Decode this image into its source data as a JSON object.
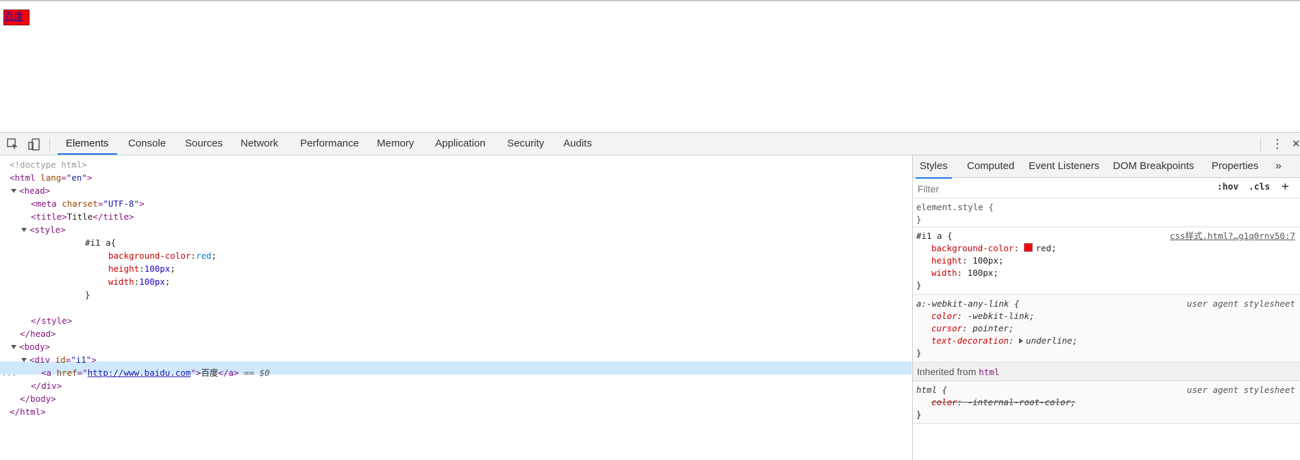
{
  "page": {
    "link_text": "百度"
  },
  "devtools": {
    "tabs": [
      "Elements",
      "Console",
      "Sources",
      "Network",
      "Performance",
      "Memory",
      "Application",
      "Security",
      "Audits"
    ],
    "more_tabs_glyph": "»",
    "menu_glyph": "⋮",
    "close_glyph": "✕"
  },
  "elements": {
    "doctype": "<!doctype html>",
    "html_open_tag": "html",
    "html_lang_attr": "lang",
    "html_lang_val": "\"en\"",
    "head": "head",
    "meta": "meta",
    "meta_attr": "charset",
    "meta_val": "\"UTF-8\"",
    "title_tag": "title",
    "title_text": "Title",
    "style_tag": "style",
    "css_selector": "#i1 a{",
    "css_props": [
      {
        "name": "background-color",
        "value": "red"
      },
      {
        "name": "height",
        "value": "100px"
      },
      {
        "name": "width",
        "value": "100px"
      }
    ],
    "css_close": "}",
    "body": "body",
    "div": "div",
    "div_attr": "id",
    "div_val": "\"i1\"",
    "a": "a",
    "a_attr": "href",
    "a_href": "http://www.baidu.com",
    "a_text": "百度",
    "selected_marker": "== $0",
    "row_dots": "..."
  },
  "styles": {
    "tabs": [
      "Styles",
      "Computed",
      "Event Listeners",
      "DOM Breakpoints",
      "Properties"
    ],
    "more": "»",
    "filter_placeholder": "Filter",
    "hov": ":hov",
    "cls": ".cls",
    "add": "+",
    "element_style": "element.style {",
    "close_brace": "}",
    "rule1": {
      "selector": "#i1 a {",
      "source": "css样式.html?…g1q0rnv50:7",
      "props": [
        {
          "name": "background-color",
          "value": "red"
        },
        {
          "name": "height",
          "value": "100px"
        },
        {
          "name": "width",
          "value": "100px"
        }
      ]
    },
    "rule2": {
      "selector": "a:-webkit-any-link {",
      "source": "user agent stylesheet",
      "props": [
        {
          "name": "color",
          "value": "-webkit-link"
        },
        {
          "name": "cursor",
          "value": "pointer"
        },
        {
          "name": "text-decoration",
          "value": "underline"
        }
      ]
    },
    "inherited_label": "Inherited from",
    "inherited_tag": "html",
    "rule3": {
      "selector": "html {",
      "source": "user agent stylesheet",
      "props": [
        {
          "name": "color",
          "value": "-internal-root-color"
        }
      ]
    }
  }
}
